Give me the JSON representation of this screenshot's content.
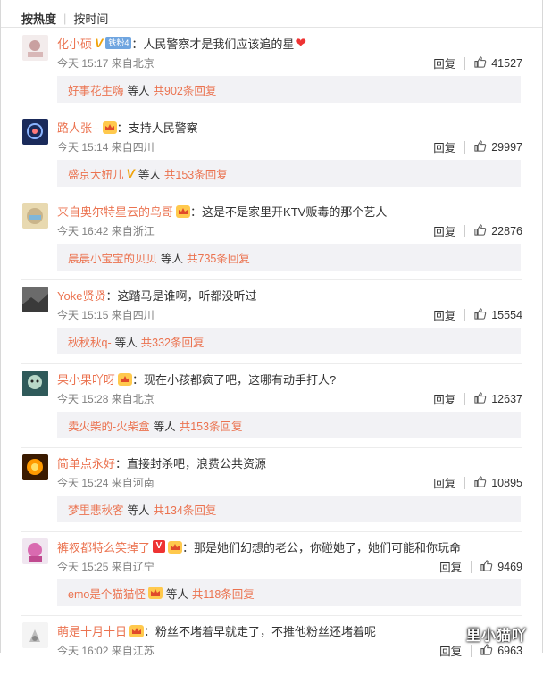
{
  "sort": {
    "hot": "按热度",
    "time": "按时间"
  },
  "comments": [
    {
      "user": "化小硕",
      "badges": [
        "v-gold",
        "fan"
      ],
      "fan_label": "铁粉4",
      "text": "人民警察才是我们应该追的星",
      "heart": "❤",
      "date": "今天 15:17",
      "location": "来自北京",
      "reply": "回复",
      "likes": "41527",
      "sub_user": "好事花生嗨",
      "sub_suffix": "等人",
      "sub_count": "共902条回复"
    },
    {
      "user": "路人张--",
      "badges": [
        "crown"
      ],
      "text": "支持人民警察",
      "date": "今天 15:14",
      "location": "来自四川",
      "reply": "回复",
      "likes": "29997",
      "sub_user": "盛京大妞儿",
      "sub_badge": "v-gold",
      "sub_suffix": "等人",
      "sub_count": "共153条回复"
    },
    {
      "user": "来自奥尔特星云的鸟哥",
      "badges": [
        "crown"
      ],
      "text": "这是不是家里开KTV贩毒的那个艺人",
      "date": "今天 16:42",
      "location": "来自浙江",
      "reply": "回复",
      "likes": "22876",
      "sub_user": "晨晨小宝宝的贝贝",
      "sub_suffix": "等人",
      "sub_count": "共735条回复"
    },
    {
      "user": "Yoke贤贤",
      "badges": [],
      "text": "这踏马是谁啊，听都没听过",
      "date": "今天 15:15",
      "location": "来自四川",
      "reply": "回复",
      "likes": "15554",
      "sub_user": "秋秋秋q-",
      "sub_suffix": "等人",
      "sub_count": "共332条回复"
    },
    {
      "user": "果小果吖呀",
      "badges": [
        "crown"
      ],
      "text": "现在小孩都疯了吧，这哪有动手打人?",
      "date": "今天 15:28",
      "location": "来自北京",
      "reply": "回复",
      "likes": "12637",
      "sub_user": "卖火柴的-火柴盒",
      "sub_suffix": "等人",
      "sub_count": "共153条回复"
    },
    {
      "user": "简单点永好",
      "badges": [],
      "text": "直接封杀吧，浪费公共资源",
      "date": "今天 15:24",
      "location": "来自河南",
      "reply": "回复",
      "likes": "10895",
      "sub_user": "梦里悲秋客",
      "sub_suffix": "等人",
      "sub_count": "共134条回复"
    },
    {
      "user": "裤衩都特么笑掉了",
      "badges": [
        "v-red",
        "crown"
      ],
      "text": "那是她们幻想的老公，你碰她了，她们可能和你玩命",
      "date": "今天 15:25",
      "location": "来自辽宁",
      "reply": "回复",
      "likes": "9469",
      "sub_user": "emo是个猫猫怪",
      "sub_badge": "crown",
      "sub_suffix": "等人",
      "sub_count": "共118条回复"
    },
    {
      "user": "萌是十月十日",
      "badges": [
        "crown"
      ],
      "text": "粉丝不堵着早就走了，不推他粉丝还堵着呢",
      "date": "今天 16:02",
      "location": "来自江苏",
      "reply": "回复",
      "likes": "6963"
    }
  ],
  "watermark": "里小猫吖",
  "colors": {
    "username": "#eb7350",
    "meta": "#808080",
    "subbox": "#f2f2f5"
  },
  "icons": {
    "like": "thumbs-up-icon",
    "crown": "crown-badge-icon",
    "vip": "v-badge-icon"
  }
}
